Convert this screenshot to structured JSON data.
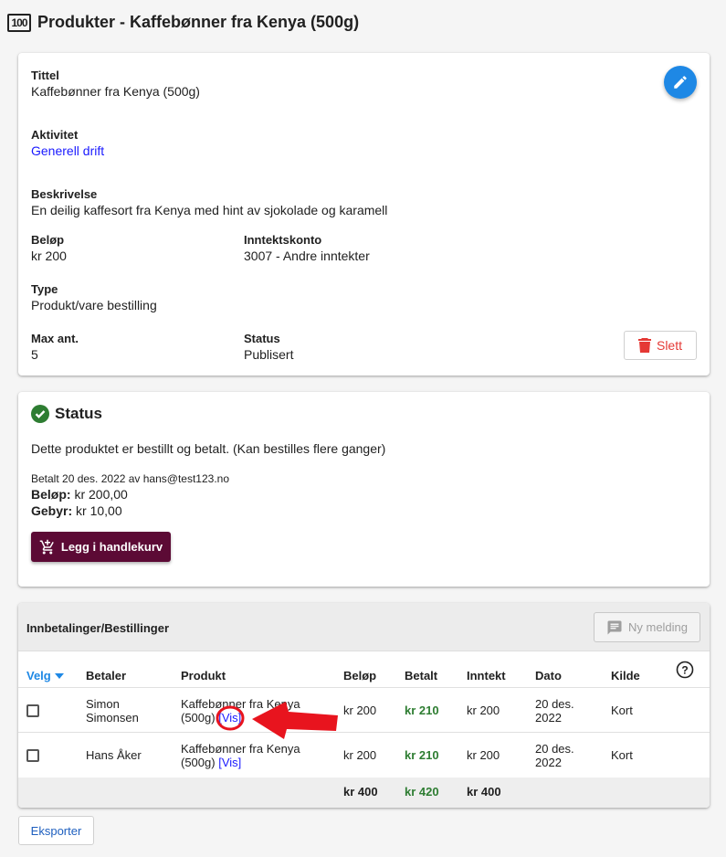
{
  "header": {
    "icon_text": "100",
    "title": "Produkter - Kaffebønner fra Kenya (500g)"
  },
  "details": {
    "title_label": "Tittel",
    "title_value": "Kaffebønner fra Kenya (500g)",
    "activity_label": "Aktivitet",
    "activity_value": "Generell drift",
    "description_label": "Beskrivelse",
    "description_value": "En deilig kaffesort fra Kenya med hint av sjokolade og karamell",
    "amount_label": "Beløp",
    "amount_value": "kr 200",
    "account_label": "Inntektskonto",
    "account_value": "3007 - Andre inntekter",
    "type_label": "Type",
    "type_value": "Produkt/vare bestilling",
    "max_label": "Max ant.",
    "max_value": "5",
    "status_label": "Status",
    "status_value": "Publisert",
    "delete_label": "Slett"
  },
  "status_card": {
    "title": "Status",
    "message": "Dette produktet er bestillt og betalt. (Kan bestilles flere ganger)",
    "paid_info": "Betalt 20 des. 2022 av hans@test123.no",
    "amount_label": "Beløp:",
    "amount_value": " kr 200,00",
    "fee_label": "Gebyr:",
    "fee_value": " kr 10,00",
    "cart_button": "Legg i handlekurv"
  },
  "payments": {
    "title": "Innbetalinger/Bestillinger",
    "new_message_button": "Ny melding",
    "columns": [
      "Velg",
      "Betaler",
      "Produkt",
      "Beløp",
      "Betalt",
      "Inntekt",
      "Dato",
      "Kilde"
    ],
    "rows": [
      {
        "payer_line1": "Simon",
        "payer_line2": "Simonsen",
        "product_line1": "Kaffebønner fra Kenya",
        "product_line2": "(500g)",
        "view_link": "[Vis]",
        "amount": "kr 200",
        "paid": "kr 210",
        "income": "kr 200",
        "date_line1": "20 des.",
        "date_line2": "2022",
        "source": "Kort"
      },
      {
        "payer_line1": "Hans Åker",
        "payer_line2": "",
        "product_line1": "Kaffebønner fra Kenya",
        "product_line2": "(500g)",
        "view_link": "[Vis]",
        "amount": "kr 200",
        "paid": "kr 210",
        "income": "kr 200",
        "date_line1": "20 des.",
        "date_line2": "2022",
        "source": "Kort"
      }
    ],
    "totals": {
      "amount": "kr 400",
      "paid": "kr 420",
      "income": "kr 400"
    }
  },
  "export_button": "Eksporter",
  "colors": {
    "accent": "#1e88e5",
    "cart_button": "#5c0a35",
    "delete": "#e53935",
    "paid_green": "#2e7d32",
    "annotation_red": "#e8141e"
  }
}
